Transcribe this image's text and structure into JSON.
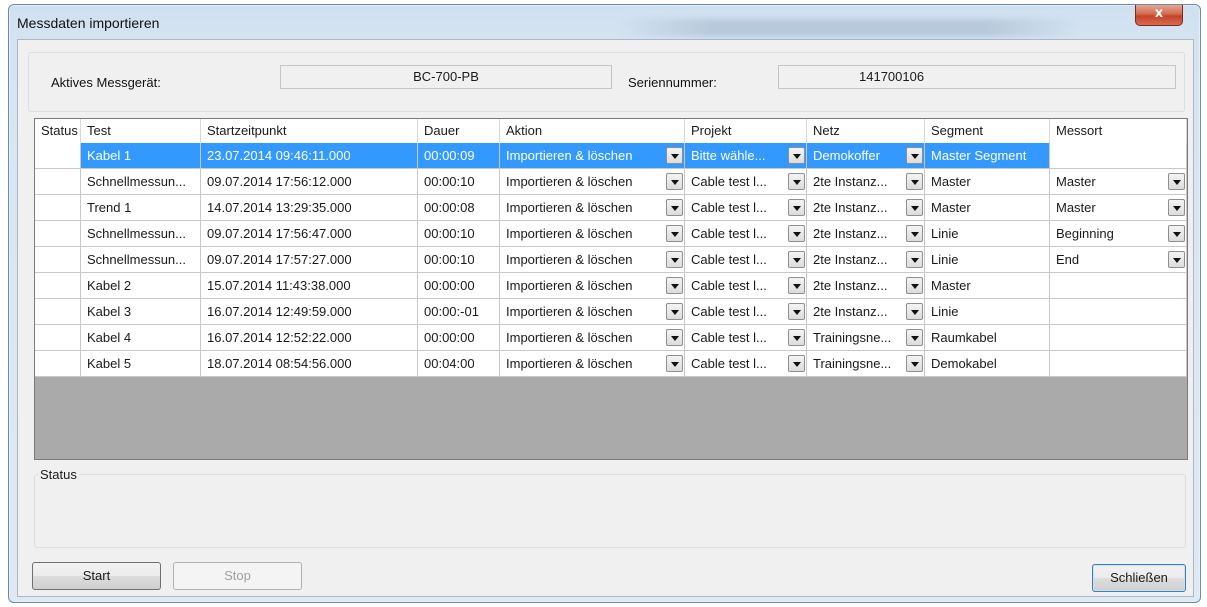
{
  "window": {
    "title": "Messdaten importieren",
    "close_glyph": "x"
  },
  "device": {
    "active_label": "Aktives Messgerät:",
    "active_value": "BC-700-PB",
    "serial_label": "Seriennummer:",
    "serial_value": "141700106"
  },
  "table": {
    "columns": [
      "Status",
      "Test",
      "Startzeitpunkt",
      "Dauer",
      "Aktion",
      "Projekt",
      "Netz",
      "Segment",
      "Messort"
    ],
    "rows": [
      {
        "status": "",
        "test": "Kabel 1",
        "start": "23.07.2014 09:46:11.000",
        "dauer": "00:00:09",
        "aktion": "Importieren & löschen",
        "projekt": "Bitte wähle...",
        "netz": "Demokoffer",
        "segment": "Master Segment",
        "messort": ""
      },
      {
        "status": "",
        "test": "Schnellmessun...",
        "start": "09.07.2014 17:56:12.000",
        "dauer": "00:00:10",
        "aktion": "Importieren & löschen",
        "projekt": "Cable test l...",
        "netz": "2te Instanz...",
        "segment": "Master",
        "messort": "Master"
      },
      {
        "status": "",
        "test": "Trend 1",
        "start": "14.07.2014 13:29:35.000",
        "dauer": "00:00:08",
        "aktion": "Importieren & löschen",
        "projekt": "Cable test l...",
        "netz": "2te Instanz...",
        "segment": "Master",
        "messort": "Master"
      },
      {
        "status": "",
        "test": "Schnellmessun...",
        "start": "09.07.2014 17:56:47.000",
        "dauer": "00:00:10",
        "aktion": "Importieren & löschen",
        "projekt": "Cable test l...",
        "netz": "2te Instanz...",
        "segment": "Linie",
        "messort": "Beginning"
      },
      {
        "status": "",
        "test": "Schnellmessun...",
        "start": "09.07.2014 17:57:27.000",
        "dauer": "00:00:10",
        "aktion": "Importieren & löschen",
        "projekt": "Cable test l...",
        "netz": "2te Instanz...",
        "segment": "Linie",
        "messort": "End"
      },
      {
        "status": "",
        "test": "Kabel 2",
        "start": "15.07.2014 11:43:38.000",
        "dauer": "00:00:00",
        "aktion": "Importieren & löschen",
        "projekt": "Cable test l...",
        "netz": "2te Instanz...",
        "segment": "Master",
        "messort": ""
      },
      {
        "status": "",
        "test": "Kabel 3",
        "start": "16.07.2014 12:49:59.000",
        "dauer": "00:00:-01",
        "aktion": "Importieren & löschen",
        "projekt": "Cable test l...",
        "netz": "2te Instanz...",
        "segment": "Linie",
        "messort": ""
      },
      {
        "status": "",
        "test": "Kabel 4",
        "start": "16.07.2014 12:52:22.000",
        "dauer": "00:00:00",
        "aktion": "Importieren & löschen",
        "projekt": "Cable test l...",
        "netz": "Trainingsne...",
        "segment": "Raumkabel",
        "messort": ""
      },
      {
        "status": "",
        "test": "Kabel 5",
        "start": "18.07.2014 08:54:56.000",
        "dauer": "00:04:00",
        "aktion": "Importieren & löschen",
        "projekt": "Cable test l...",
        "netz": "Trainingsne...",
        "segment": "Demokabel",
        "messort": ""
      }
    ]
  },
  "status_group": {
    "label": "Status"
  },
  "buttons": {
    "start": "Start",
    "stop": "Stop",
    "close": "Schließen"
  },
  "colors": {
    "selection": "#3399ff",
    "empty_grid": "#aaaaaa"
  }
}
